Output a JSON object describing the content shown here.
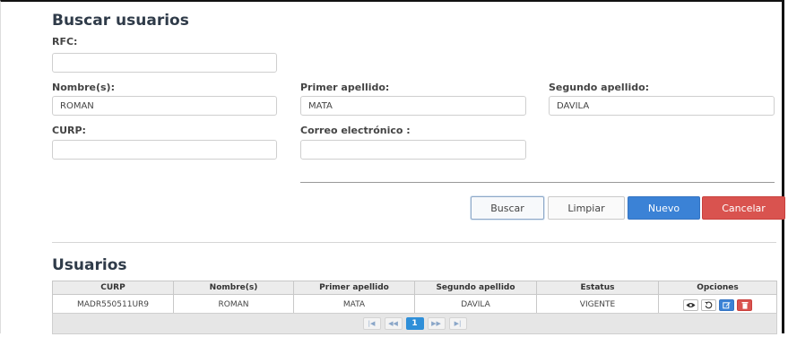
{
  "search": {
    "title": "Buscar usuarios",
    "rfc": {
      "label": "RFC:",
      "value": ""
    },
    "nombre": {
      "label": "Nombre(s):",
      "value": "ROMAN"
    },
    "primer_apellido": {
      "label": "Primer apellido:",
      "value": "MATA"
    },
    "segundo_apellido": {
      "label": "Segundo apellido:",
      "value": "DAVILA"
    },
    "curp": {
      "label": "CURP:",
      "value": ""
    },
    "correo": {
      "label": "Correo electrónico :",
      "value": ""
    }
  },
  "actions": {
    "buscar": "Buscar",
    "limpiar": "Limpiar",
    "nuevo": "Nuevo",
    "cancelar": "Cancelar"
  },
  "results": {
    "title": "Usuarios",
    "columns": [
      "CURP",
      "Nombre(s)",
      "Primer apellido",
      "Segundo apellido",
      "Estatus",
      "Opciones"
    ],
    "rows": [
      {
        "curp": "MADR550511UR9",
        "nombre": "ROMAN",
        "primer_apellido": "MATA",
        "segundo_apellido": "DAVILA",
        "estatus": "VIGENTE"
      }
    ],
    "row_options": [
      "eye-icon",
      "history-icon",
      "edit-icon",
      "delete-icon"
    ]
  },
  "pagination": {
    "first": "|◀",
    "prev": "◀◀",
    "current": "1",
    "next": "▶▶",
    "last": "▶|"
  },
  "colors": {
    "primary": "#3b82d6",
    "danger": "#d9534f",
    "heading": "#2f3b49",
    "page_active": "#2f8fd8"
  }
}
